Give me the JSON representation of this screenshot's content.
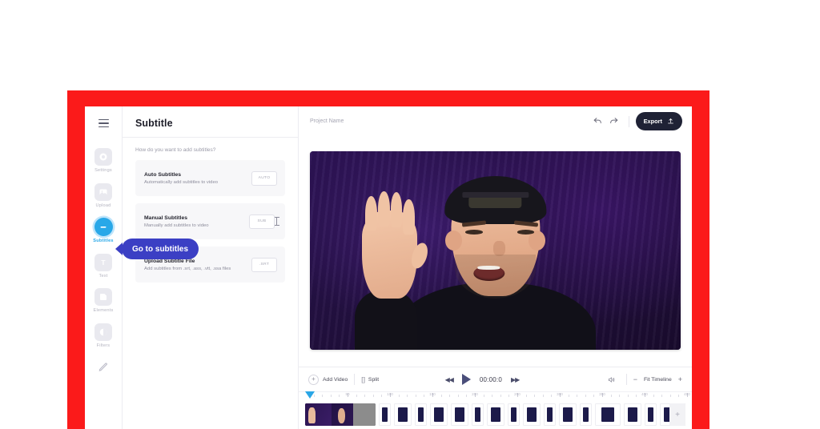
{
  "app": {
    "menu_icon": "hamburger-icon"
  },
  "rail": {
    "items": [
      {
        "label": "Settings",
        "icon": "gear-icon",
        "active": false
      },
      {
        "label": "Upload",
        "icon": "image-upload-icon",
        "active": false
      },
      {
        "label": "Subtitles",
        "icon": "subtitle-icon",
        "active": true
      },
      {
        "label": "Text",
        "icon": "text-icon",
        "active": false
      },
      {
        "label": "Elements",
        "icon": "shapes-icon",
        "active": false
      },
      {
        "label": "Filters",
        "icon": "contrast-icon",
        "active": false
      },
      {
        "label": "",
        "icon": "pen-icon",
        "active": false
      }
    ]
  },
  "panel": {
    "title": "Subtitle",
    "question": "How do you want to add subtitles?",
    "options": [
      {
        "title": "Auto Subtitles",
        "subtitle": "Automatically add subtitles to video",
        "badge": "AUTO"
      },
      {
        "title": "Manual Subtitles",
        "subtitle": "Manually add subtitles to video",
        "badge": "SUB"
      },
      {
        "title": "Upload Subtitle File",
        "subtitle": "Add subtitles from .srt, .ass, .vtt, .ssa files",
        "badge": ".SRT"
      }
    ]
  },
  "callout": {
    "text": "Go to subtitles",
    "color": "#3b3fc4"
  },
  "topbar": {
    "project_name": "Project Name",
    "undo_icon": "undo-arrow-icon",
    "redo_icon": "redo-arrow-icon",
    "export_label": "Export",
    "export_icon": "upload-icon",
    "export_color": "#1f2235"
  },
  "preview": {
    "description": "Video preview: person waving in front of purple backdrop",
    "background_color": "#231048"
  },
  "controls": {
    "add_video_label": "Add Video",
    "add_video_icon": "plus-circle-icon",
    "split_label": "Split",
    "split_icon": "split-brackets-icon",
    "rewind_icon": "rewind-icon",
    "play_icon": "play-icon",
    "forward_icon": "fast-forward-icon",
    "time": "00:00:0",
    "volume_icon": "speaker-icon",
    "zoom_out_label": "−",
    "fit_label": "Fit Timeline",
    "zoom_in_label": "+"
  },
  "timeline": {
    "playhead_color": "#2aa6e6",
    "ruler_labels": [
      "50",
      "100",
      "150",
      "200",
      "250",
      "300",
      "350",
      "400",
      "450",
      "500",
      "550"
    ],
    "add_clip_label": "+"
  }
}
